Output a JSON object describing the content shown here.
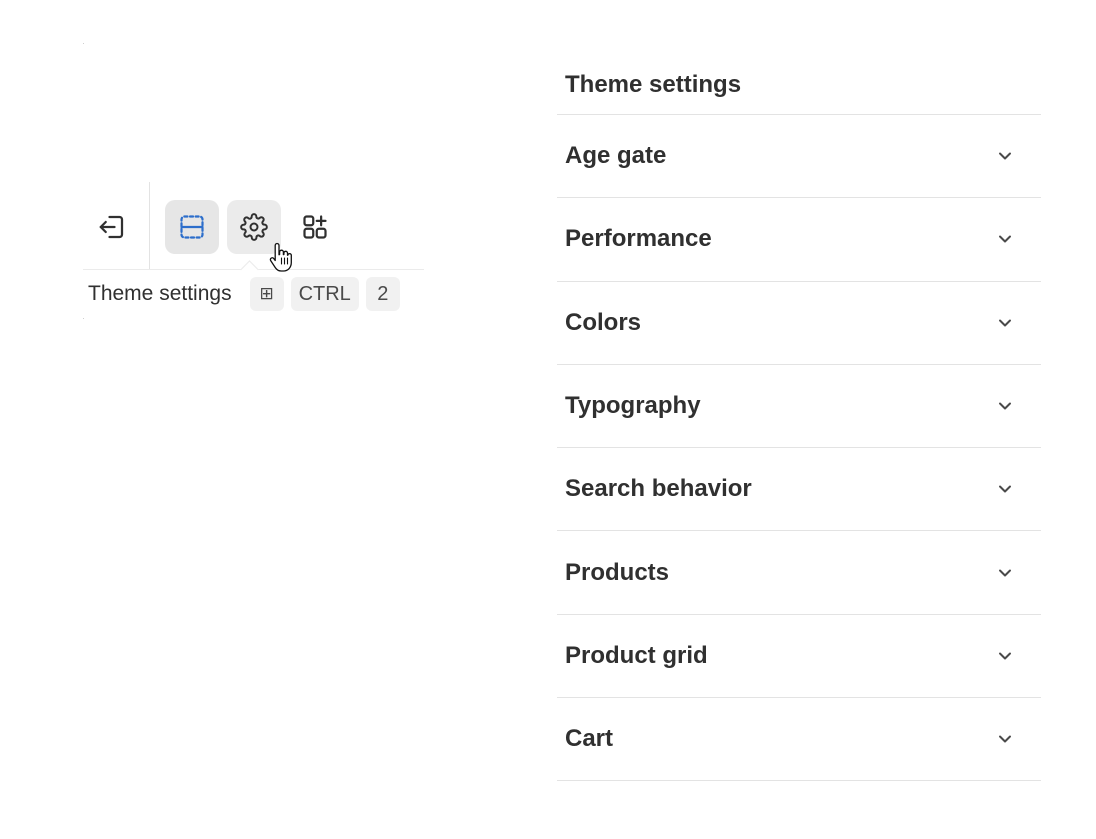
{
  "toolbar": {
    "buttons": [
      {
        "icon": "exit-icon",
        "label": ""
      },
      {
        "icon": "sections-icon",
        "label": ""
      },
      {
        "icon": "gear-icon",
        "label": ""
      },
      {
        "icon": "add-apps-icon",
        "label": ""
      }
    ],
    "active_color": "#2c6ecb"
  },
  "tooltip": {
    "label": "Theme settings",
    "shortcut_keys": [
      "⊞",
      "CTRL",
      "2"
    ]
  },
  "panel": {
    "title": "Theme settings",
    "sections": [
      {
        "label": "Age gate"
      },
      {
        "label": "Performance"
      },
      {
        "label": "Colors"
      },
      {
        "label": "Typography"
      },
      {
        "label": "Search behavior"
      },
      {
        "label": "Products"
      },
      {
        "label": "Product grid"
      },
      {
        "label": "Cart"
      }
    ]
  }
}
